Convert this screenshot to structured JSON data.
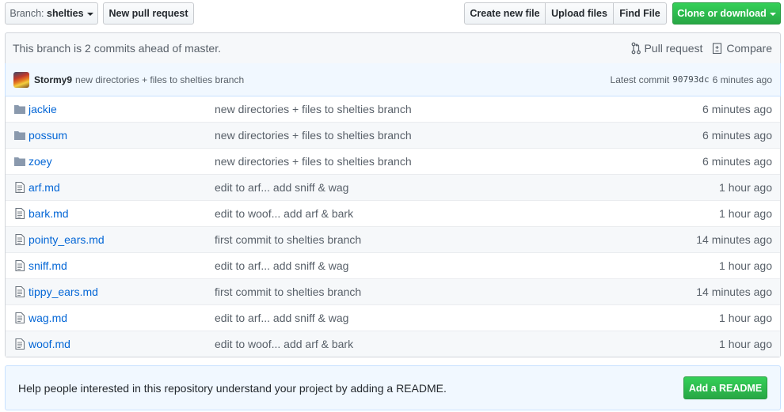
{
  "toolbar": {
    "branch_prefix": "Branch:",
    "branch_name": "shelties",
    "new_pull_request": "New pull request",
    "create_new_file": "Create new file",
    "upload_files": "Upload files",
    "find_file": "Find File",
    "clone_or_download": "Clone or download"
  },
  "branch_info": {
    "text": "This branch is 2 commits ahead of master.",
    "pull_request": "Pull request",
    "compare": "Compare"
  },
  "latest_commit": {
    "author": "Stormy9",
    "message": "new directories + files to shelties branch",
    "label": "Latest commit",
    "sha": "90793dc",
    "age": "6 minutes ago"
  },
  "files": [
    {
      "type": "dir",
      "name": "jackie",
      "message": "new directories + files to shelties branch",
      "age": "6 minutes ago"
    },
    {
      "type": "dir",
      "name": "possum",
      "message": "new directories + files to shelties branch",
      "age": "6 minutes ago"
    },
    {
      "type": "dir",
      "name": "zoey",
      "message": "new directories + files to shelties branch",
      "age": "6 minutes ago"
    },
    {
      "type": "file",
      "name": "arf.md",
      "message": "edit to arf... add sniff & wag",
      "age": "1 hour ago"
    },
    {
      "type": "file",
      "name": "bark.md",
      "message": "edit to woof... add arf & bark",
      "age": "1 hour ago"
    },
    {
      "type": "file",
      "name": "pointy_ears.md",
      "message": "first commit to shelties branch",
      "age": "14 minutes ago"
    },
    {
      "type": "file",
      "name": "sniff.md",
      "message": "edit to arf... add sniff & wag",
      "age": "1 hour ago"
    },
    {
      "type": "file",
      "name": "tippy_ears.md",
      "message": "first commit to shelties branch",
      "age": "14 minutes ago"
    },
    {
      "type": "file",
      "name": "wag.md",
      "message": "edit to arf... add sniff & wag",
      "age": "1 hour ago"
    },
    {
      "type": "file",
      "name": "woof.md",
      "message": "edit to woof... add arf & bark",
      "age": "1 hour ago"
    }
  ],
  "readme_prompt": {
    "text": "Help people interested in this repository understand your project by adding a README.",
    "button": "Add a README"
  },
  "colors": {
    "link": "#0366d6",
    "green_button": "#28a745",
    "folder_icon": "#79b8ff",
    "file_icon": "#6a737d"
  }
}
